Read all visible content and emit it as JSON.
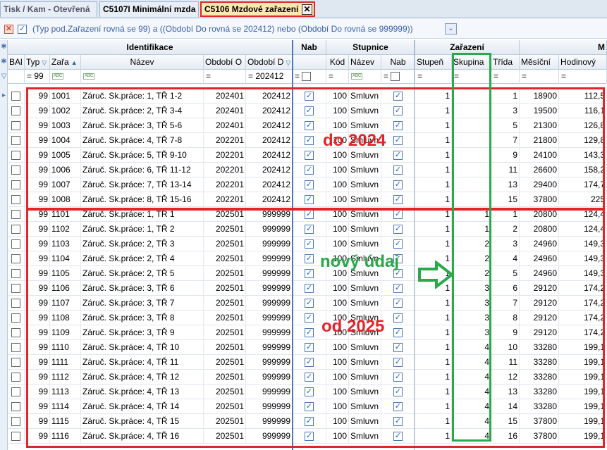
{
  "tabs": [
    {
      "label": "Tisk / Kam - Otevřená",
      "active": false
    },
    {
      "label": "C5107I Minimální mzda",
      "active": false
    },
    {
      "label": "C5106 Mzdové zařazení",
      "active": true
    }
  ],
  "filter": {
    "text": "(Typ pod.Zařazení rovná se 99) a  ((Období Do rovná se 202412) nebo (Období Do rovná se 999999))"
  },
  "bands": {
    "identifikace": "Identifikace",
    "nab": "Nab",
    "stupnice": "Stupnice",
    "zarazeni": "Zařazení",
    "m": "M"
  },
  "columns": {
    "bal": "BAl",
    "typ": "Typ",
    "zar": "Zařa",
    "nazev": "Název",
    "obdobi_od": "Období O",
    "obdobi_do": "Období D",
    "nab": "",
    "kod": "Kód",
    "st_nazev": "Název",
    "st_nab": "Nab",
    "stupen": "Stupeň",
    "skupina": "Skupina",
    "trida": "Třída",
    "mesicni": "Měsíční",
    "hodinovy": "Hodinový"
  },
  "filter_row": {
    "typ": "99",
    "obdobi_do": "202412",
    "eq": "="
  },
  "rows": [
    {
      "typ": "99",
      "zar": "1001",
      "nazev": "Záruč. Sk.práce: 1, TŘ 1-2",
      "od": "202401",
      "do": "202412",
      "kod": "100",
      "st": "Smluvn",
      "stupen": "1",
      "skupina": "",
      "trida": "1",
      "mes": "18900",
      "hod": "112,5"
    },
    {
      "typ": "99",
      "zar": "1002",
      "nazev": "Záruč. Sk.práce: 2, TŘ 3-4",
      "od": "202401",
      "do": "202412",
      "kod": "100",
      "st": "Smluvn",
      "stupen": "1",
      "skupina": "",
      "trida": "3",
      "mes": "19500",
      "hod": "116,1"
    },
    {
      "typ": "99",
      "zar": "1003",
      "nazev": "Záruč. Sk.práce: 3, TŘ 5-6",
      "od": "202401",
      "do": "202412",
      "kod": "100",
      "st": "Smluvn",
      "stupen": "1",
      "skupina": "",
      "trida": "5",
      "mes": "21300",
      "hod": "126,8"
    },
    {
      "typ": "99",
      "zar": "1004",
      "nazev": "Záruč. Sk.práce: 4, TŘ 7-8",
      "od": "202201",
      "do": "202412",
      "kod": "100",
      "st": "Smluvn",
      "stupen": "1",
      "skupina": "",
      "trida": "7",
      "mes": "21800",
      "hod": "129,8"
    },
    {
      "typ": "99",
      "zar": "1005",
      "nazev": "Záruč. Sk.práce: 5, TŘ 9-10",
      "od": "202201",
      "do": "202412",
      "kod": "100",
      "st": "Smluvn",
      "stupen": "1",
      "skupina": "",
      "trida": "9",
      "mes": "24100",
      "hod": "143,3"
    },
    {
      "typ": "99",
      "zar": "1006",
      "nazev": "Záruč. Sk.práce: 6, TŘ 11-12",
      "od": "202201",
      "do": "202412",
      "kod": "100",
      "st": "Smluvn",
      "stupen": "1",
      "skupina": "",
      "trida": "11",
      "mes": "26600",
      "hod": "158,2"
    },
    {
      "typ": "99",
      "zar": "1007",
      "nazev": "Záruč. Sk.práce: 7, TŘ 13-14",
      "od": "202201",
      "do": "202412",
      "kod": "100",
      "st": "Smluvn",
      "stupen": "1",
      "skupina": "",
      "trida": "13",
      "mes": "29400",
      "hod": "174,7"
    },
    {
      "typ": "99",
      "zar": "1008",
      "nazev": "Záruč. Sk.práce: 8, TŘ 15-16",
      "od": "202201",
      "do": "202412",
      "kod": "100",
      "st": "Smluvn",
      "stupen": "1",
      "skupina": "",
      "trida": "15",
      "mes": "37800",
      "hod": "225"
    },
    {
      "typ": "99",
      "zar": "1101",
      "nazev": "Záruč. Sk.práce: 1, TŘ 1",
      "od": "202501",
      "do": "999999",
      "kod": "100",
      "st": "Smluvn",
      "stupen": "1",
      "skupina": "1",
      "trida": "1",
      "mes": "20800",
      "hod": "124,4"
    },
    {
      "typ": "99",
      "zar": "1102",
      "nazev": "Záruč. Sk.práce: 1, TŘ 2",
      "od": "202501",
      "do": "999999",
      "kod": "100",
      "st": "Smluvn",
      "stupen": "1",
      "skupina": "1",
      "trida": "2",
      "mes": "20800",
      "hod": "124,4"
    },
    {
      "typ": "99",
      "zar": "1103",
      "nazev": "Záruč. Sk.práce: 2, TŘ 3",
      "od": "202501",
      "do": "999999",
      "kod": "100",
      "st": "Smluvn",
      "stupen": "1",
      "skupina": "2",
      "trida": "3",
      "mes": "24960",
      "hod": "149,3"
    },
    {
      "typ": "99",
      "zar": "1104",
      "nazev": "Záruč. Sk.práce: 2, TŘ 4",
      "od": "202501",
      "do": "999999",
      "kod": "100",
      "st": "Smluvn",
      "stupen": "1",
      "skupina": "2",
      "trida": "4",
      "mes": "24960",
      "hod": "149,3"
    },
    {
      "typ": "99",
      "zar": "1105",
      "nazev": "Záruč. Sk.práce: 2, TŘ 5",
      "od": "202501",
      "do": "999999",
      "kod": "100",
      "st": "Smluvn",
      "stupen": "1",
      "skupina": "2",
      "trida": "5",
      "mes": "24960",
      "hod": "149,3"
    },
    {
      "typ": "99",
      "zar": "1106",
      "nazev": "Záruč. Sk.práce: 3, TŘ 6",
      "od": "202501",
      "do": "999999",
      "kod": "100",
      "st": "Smluvn",
      "stupen": "1",
      "skupina": "3",
      "trida": "6",
      "mes": "29120",
      "hod": "174,2"
    },
    {
      "typ": "99",
      "zar": "1107",
      "nazev": "Záruč. Sk.práce: 3, TŘ 7",
      "od": "202501",
      "do": "999999",
      "kod": "100",
      "st": "Smluvn",
      "stupen": "1",
      "skupina": "3",
      "trida": "7",
      "mes": "29120",
      "hod": "174,2"
    },
    {
      "typ": "99",
      "zar": "1108",
      "nazev": "Záruč. Sk.práce: 3, TŘ 8",
      "od": "202501",
      "do": "999999",
      "kod": "100",
      "st": "Smluvn",
      "stupen": "1",
      "skupina": "3",
      "trida": "8",
      "mes": "29120",
      "hod": "174,2"
    },
    {
      "typ": "99",
      "zar": "1109",
      "nazev": "Záruč. Sk.práce: 3, TŘ 9",
      "od": "202501",
      "do": "999999",
      "kod": "100",
      "st": "Smluvn",
      "stupen": "1",
      "skupina": "3",
      "trida": "9",
      "mes": "29120",
      "hod": "174,2"
    },
    {
      "typ": "99",
      "zar": "1110",
      "nazev": "Záruč. Sk.práce: 4, TŘ 10",
      "od": "202501",
      "do": "999999",
      "kod": "100",
      "st": "Smluvn",
      "stupen": "1",
      "skupina": "4",
      "trida": "10",
      "mes": "33280",
      "hod": "199,1"
    },
    {
      "typ": "99",
      "zar": "1111",
      "nazev": "Záruč. Sk.práce: 4, TŘ 11",
      "od": "202501",
      "do": "999999",
      "kod": "100",
      "st": "Smluvn",
      "stupen": "1",
      "skupina": "4",
      "trida": "11",
      "mes": "33280",
      "hod": "199,1"
    },
    {
      "typ": "99",
      "zar": "1112",
      "nazev": "Záruč. Sk.práce: 4, TŘ 12",
      "od": "202501",
      "do": "999999",
      "kod": "100",
      "st": "Smluvn",
      "stupen": "1",
      "skupina": "4",
      "trida": "12",
      "mes": "33280",
      "hod": "199,1"
    },
    {
      "typ": "99",
      "zar": "1113",
      "nazev": "Záruč. Sk.práce: 4, TŘ 13",
      "od": "202501",
      "do": "999999",
      "kod": "100",
      "st": "Smluvn",
      "stupen": "1",
      "skupina": "4",
      "trida": "13",
      "mes": "33280",
      "hod": "199,1"
    },
    {
      "typ": "99",
      "zar": "1114",
      "nazev": "Záruč. Sk.práce: 4, TŘ 14",
      "od": "202501",
      "do": "999999",
      "kod": "100",
      "st": "Smluvn",
      "stupen": "1",
      "skupina": "4",
      "trida": "14",
      "mes": "33280",
      "hod": "199,1"
    },
    {
      "typ": "99",
      "zar": "1115",
      "nazev": "Záruč. Sk.práce: 4, TŘ 15",
      "od": "202501",
      "do": "999999",
      "kod": "100",
      "st": "Smluvn",
      "stupen": "1",
      "skupina": "4",
      "trida": "15",
      "mes": "37800",
      "hod": "199,1"
    },
    {
      "typ": "99",
      "zar": "1116",
      "nazev": "Záruč. Sk.práce: 4, TŘ 16",
      "od": "202501",
      "do": "999999",
      "kod": "100",
      "st": "Smluvn",
      "stupen": "1",
      "skupina": "4",
      "trida": "16",
      "mes": "37800",
      "hod": "199,1"
    }
  ],
  "annotations": {
    "do2024": "do 2024",
    "od2025": "od 2025",
    "novy": "nový údaj"
  },
  "colors": {
    "red": "#e3242b",
    "green": "#2aa84a"
  }
}
